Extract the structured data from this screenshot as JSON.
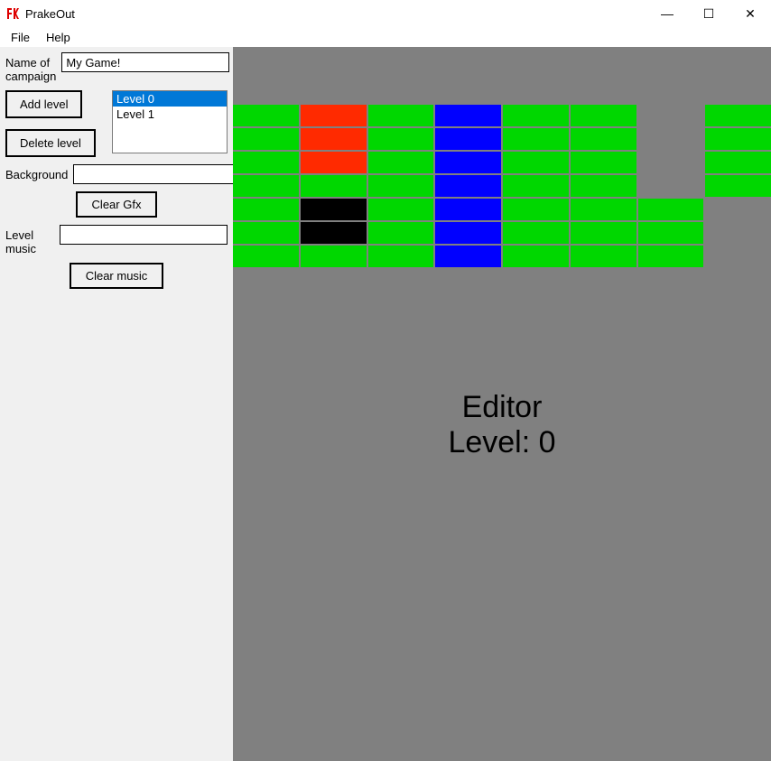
{
  "window": {
    "title": "PrakeOut",
    "controls": {
      "minimize": "—",
      "maximize": "☐",
      "close": "✕"
    }
  },
  "menu": {
    "file": "File",
    "help": "Help"
  },
  "sidebar": {
    "campaign_label": "Name of campaign",
    "campaign_value": "My Game!",
    "add_level": "Add level",
    "delete_level": "Delete level",
    "levels": [
      "Level 0",
      "Level 1"
    ],
    "selected_level_index": 0,
    "background_label": "Background",
    "background_value": "",
    "clear_gfx": "Clear Gfx",
    "music_label": "Level music",
    "music_value": "",
    "clear_music": "Clear music"
  },
  "editor": {
    "line1": "Editor",
    "line2_prefix": "Level: ",
    "current_level": 0,
    "grid": [
      [
        "green",
        "red",
        "green",
        "blue",
        "green",
        "green",
        "gray",
        "green"
      ],
      [
        "green",
        "red",
        "green",
        "blue",
        "green",
        "green",
        "gray",
        "green"
      ],
      [
        "green",
        "red",
        "green",
        "blue",
        "green",
        "green",
        "gray",
        "green"
      ],
      [
        "green",
        "green",
        "green",
        "blue",
        "green",
        "green",
        "gray",
        "green"
      ],
      [
        "green",
        "black",
        "green",
        "blue",
        "green",
        "green",
        "green",
        "gray"
      ],
      [
        "green",
        "black",
        "green",
        "blue",
        "green",
        "green",
        "green",
        "gray"
      ],
      [
        "green",
        "green",
        "green",
        "blue",
        "green",
        "green",
        "green",
        "gray"
      ]
    ]
  },
  "colors": {
    "green": "#00d700",
    "red": "#ff2a00",
    "blue": "#0000ff",
    "gray": "#808080",
    "black": "#000000"
  }
}
